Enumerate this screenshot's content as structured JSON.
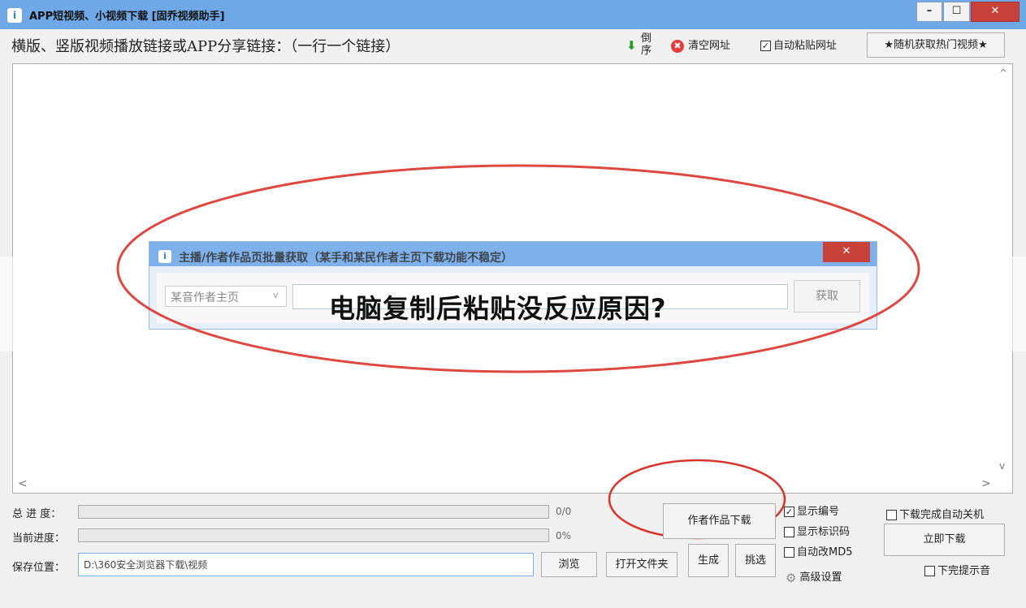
{
  "window": {
    "title": "APP短视频、小视频下载 [固乔视频助手]",
    "app_icon": "i",
    "minimize": "–",
    "maximize": "☐",
    "close": "✕"
  },
  "toolbar": {
    "link_label": "横版、竖版视频播放链接或APP分享链接：（一行一个链接）",
    "sort_arrow": "⬇",
    "sort_label": "倒序",
    "clear_icon": "✖",
    "clear_label": "清空网址",
    "autopaste_check": "✓",
    "autopaste_label": "自动粘贴网址",
    "hot_button": "★随机获取热门视频★"
  },
  "main": {
    "scroll_up": "^",
    "scroll_down": "v",
    "scroll_left": "<",
    "scroll_right": ">"
  },
  "subdialog": {
    "icon": "i",
    "title": "主播/作者作品页批量获取（某手和某民作者主页下载功能不稳定）",
    "close": "✕",
    "select_value": "某音作者主页",
    "select_arrow": "v",
    "fetch_button": "获取"
  },
  "headline": "电脑复制后粘贴没反应原因?",
  "progress": {
    "total_label": "总 进 度：",
    "total_value": "0/0",
    "total_fraction": 0,
    "current_label": "当前进度：",
    "current_value": "0%",
    "current_fraction": 0
  },
  "save": {
    "label": "保存位置：",
    "path": "D:\\360安全浏览器下载\\视频",
    "browse": "浏览",
    "open_folder": "打开文件夹"
  },
  "actions": {
    "author_download": "作者作品下载",
    "generate": "生成",
    "pick": "挑选",
    "download_now": "立即下载"
  },
  "options": {
    "show_number": "显示编号",
    "show_number_check": "✓",
    "show_id": "显示标识码",
    "auto_md5": "自动改MD5",
    "advanced": "高级设置",
    "gear_icon": "⚙",
    "shutdown": "下载完成自动关机",
    "sound": "下完提示音"
  },
  "colors": {
    "titlebar": "#6fa8e6",
    "annotation_ellipse": "#d9342b"
  }
}
